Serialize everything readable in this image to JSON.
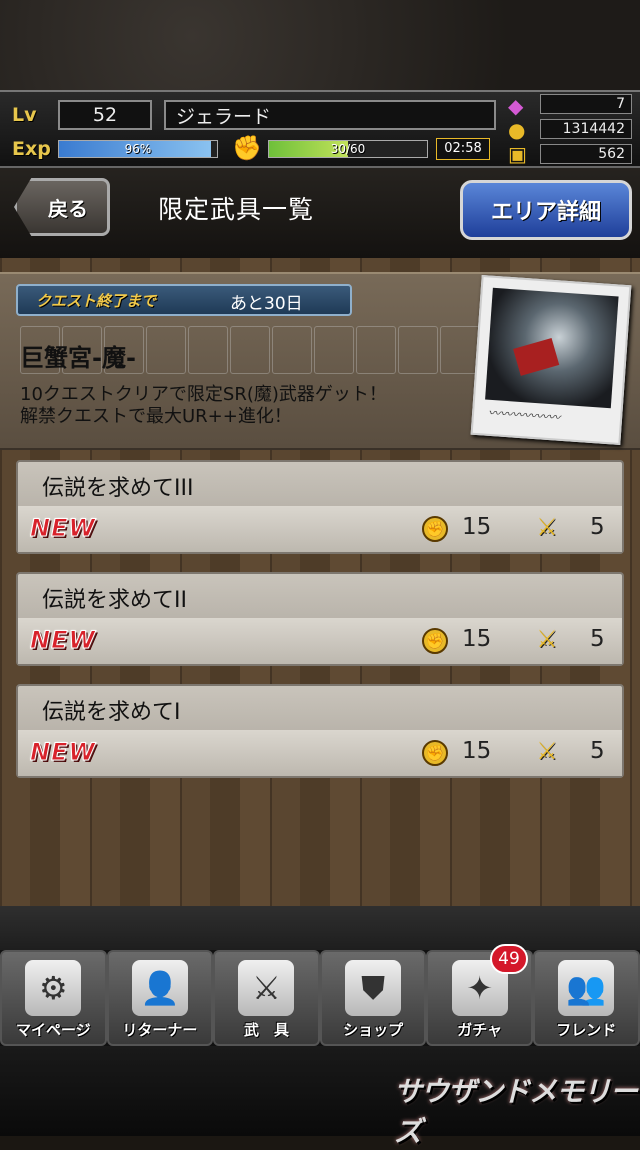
{
  "status": {
    "lv_label": "Lv",
    "lv": "52",
    "name": "ジェラード",
    "exp_label": "Exp",
    "exp_percent_text": "96%",
    "exp_fill": 0.96,
    "stamina_text": "30/60",
    "stamina_fill": 0.5,
    "timer": "02:58",
    "gems": "7",
    "gold": "1314442",
    "coins": "562"
  },
  "header": {
    "back_label": "戻る",
    "title": "限定武具一覧",
    "area_button_label": "エリア詳細"
  },
  "quest_info": {
    "ribbon_label": "クエスト終了まで",
    "remaining": "あと30日",
    "title": "巨蟹宮-魔-",
    "desc_line1": "10クエストクリアで限定SR(魔)武器ゲット！",
    "desc_line2": "解禁クエストで最大UR++進化！"
  },
  "quests": [
    {
      "name": "伝説を求めてIII",
      "tag": "NEW",
      "stamina": "15",
      "battles": "5"
    },
    {
      "name": "伝説を求めてII",
      "tag": "NEW",
      "stamina": "15",
      "battles": "5"
    },
    {
      "name": "伝説を求めてI",
      "tag": "NEW",
      "stamina": "15",
      "battles": "5"
    }
  ],
  "nav": {
    "items": [
      {
        "label": "マイページ",
        "icon": "gear-icon"
      },
      {
        "label": "リターナー",
        "icon": "portrait-icon"
      },
      {
        "label": "武　具",
        "icon": "weapon-icon"
      },
      {
        "label": "ショップ",
        "icon": "shop-icon"
      },
      {
        "label": "ガチャ",
        "icon": "gacha-icon"
      },
      {
        "label": "フレンド",
        "icon": "friends-icon"
      }
    ],
    "gacha_badge": "49"
  },
  "footer": {
    "logo_text": "サウザンドメモリーズ"
  }
}
